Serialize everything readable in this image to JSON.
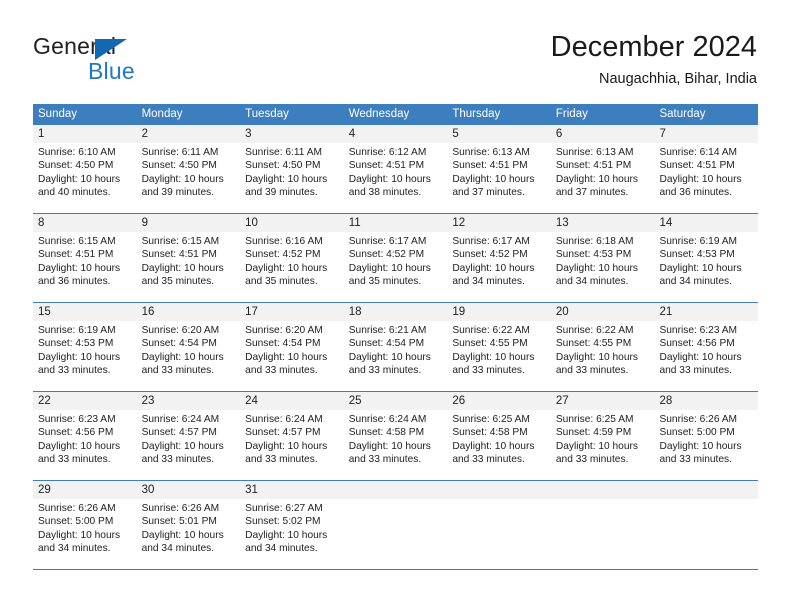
{
  "logo": {
    "primary_text": "General",
    "secondary_text": "Blue",
    "triangle_icon": "triangle-icon",
    "primary_color": "#231f20",
    "secondary_color": "#1f7ac4"
  },
  "header": {
    "title": "December 2024",
    "subtitle": "Naugachhia, Bihar, India"
  },
  "theme": {
    "header_blue": "#3d7ebe",
    "date_band_gray": "#f2f2f2",
    "text_color": "#222222"
  },
  "weekdays": [
    "Sunday",
    "Monday",
    "Tuesday",
    "Wednesday",
    "Thursday",
    "Friday",
    "Saturday"
  ],
  "weeks": [
    {
      "days": [
        {
          "date": "1",
          "sunrise": "Sunrise: 6:10 AM",
          "sunset": "Sunset: 4:50 PM",
          "daylight_1": "Daylight: 10 hours",
          "daylight_2": "and 40 minutes."
        },
        {
          "date": "2",
          "sunrise": "Sunrise: 6:11 AM",
          "sunset": "Sunset: 4:50 PM",
          "daylight_1": "Daylight: 10 hours",
          "daylight_2": "and 39 minutes."
        },
        {
          "date": "3",
          "sunrise": "Sunrise: 6:11 AM",
          "sunset": "Sunset: 4:50 PM",
          "daylight_1": "Daylight: 10 hours",
          "daylight_2": "and 39 minutes."
        },
        {
          "date": "4",
          "sunrise": "Sunrise: 6:12 AM",
          "sunset": "Sunset: 4:51 PM",
          "daylight_1": "Daylight: 10 hours",
          "daylight_2": "and 38 minutes."
        },
        {
          "date": "5",
          "sunrise": "Sunrise: 6:13 AM",
          "sunset": "Sunset: 4:51 PM",
          "daylight_1": "Daylight: 10 hours",
          "daylight_2": "and 37 minutes."
        },
        {
          "date": "6",
          "sunrise": "Sunrise: 6:13 AM",
          "sunset": "Sunset: 4:51 PM",
          "daylight_1": "Daylight: 10 hours",
          "daylight_2": "and 37 minutes."
        },
        {
          "date": "7",
          "sunrise": "Sunrise: 6:14 AM",
          "sunset": "Sunset: 4:51 PM",
          "daylight_1": "Daylight: 10 hours",
          "daylight_2": "and 36 minutes."
        }
      ]
    },
    {
      "days": [
        {
          "date": "8",
          "sunrise": "Sunrise: 6:15 AM",
          "sunset": "Sunset: 4:51 PM",
          "daylight_1": "Daylight: 10 hours",
          "daylight_2": "and 36 minutes."
        },
        {
          "date": "9",
          "sunrise": "Sunrise: 6:15 AM",
          "sunset": "Sunset: 4:51 PM",
          "daylight_1": "Daylight: 10 hours",
          "daylight_2": "and 35 minutes."
        },
        {
          "date": "10",
          "sunrise": "Sunrise: 6:16 AM",
          "sunset": "Sunset: 4:52 PM",
          "daylight_1": "Daylight: 10 hours",
          "daylight_2": "and 35 minutes."
        },
        {
          "date": "11",
          "sunrise": "Sunrise: 6:17 AM",
          "sunset": "Sunset: 4:52 PM",
          "daylight_1": "Daylight: 10 hours",
          "daylight_2": "and 35 minutes."
        },
        {
          "date": "12",
          "sunrise": "Sunrise: 6:17 AM",
          "sunset": "Sunset: 4:52 PM",
          "daylight_1": "Daylight: 10 hours",
          "daylight_2": "and 34 minutes."
        },
        {
          "date": "13",
          "sunrise": "Sunrise: 6:18 AM",
          "sunset": "Sunset: 4:53 PM",
          "daylight_1": "Daylight: 10 hours",
          "daylight_2": "and 34 minutes."
        },
        {
          "date": "14",
          "sunrise": "Sunrise: 6:19 AM",
          "sunset": "Sunset: 4:53 PM",
          "daylight_1": "Daylight: 10 hours",
          "daylight_2": "and 34 minutes."
        }
      ]
    },
    {
      "days": [
        {
          "date": "15",
          "sunrise": "Sunrise: 6:19 AM",
          "sunset": "Sunset: 4:53 PM",
          "daylight_1": "Daylight: 10 hours",
          "daylight_2": "and 33 minutes."
        },
        {
          "date": "16",
          "sunrise": "Sunrise: 6:20 AM",
          "sunset": "Sunset: 4:54 PM",
          "daylight_1": "Daylight: 10 hours",
          "daylight_2": "and 33 minutes."
        },
        {
          "date": "17",
          "sunrise": "Sunrise: 6:20 AM",
          "sunset": "Sunset: 4:54 PM",
          "daylight_1": "Daylight: 10 hours",
          "daylight_2": "and 33 minutes."
        },
        {
          "date": "18",
          "sunrise": "Sunrise: 6:21 AM",
          "sunset": "Sunset: 4:54 PM",
          "daylight_1": "Daylight: 10 hours",
          "daylight_2": "and 33 minutes."
        },
        {
          "date": "19",
          "sunrise": "Sunrise: 6:22 AM",
          "sunset": "Sunset: 4:55 PM",
          "daylight_1": "Daylight: 10 hours",
          "daylight_2": "and 33 minutes."
        },
        {
          "date": "20",
          "sunrise": "Sunrise: 6:22 AM",
          "sunset": "Sunset: 4:55 PM",
          "daylight_1": "Daylight: 10 hours",
          "daylight_2": "and 33 minutes."
        },
        {
          "date": "21",
          "sunrise": "Sunrise: 6:23 AM",
          "sunset": "Sunset: 4:56 PM",
          "daylight_1": "Daylight: 10 hours",
          "daylight_2": "and 33 minutes."
        }
      ]
    },
    {
      "days": [
        {
          "date": "22",
          "sunrise": "Sunrise: 6:23 AM",
          "sunset": "Sunset: 4:56 PM",
          "daylight_1": "Daylight: 10 hours",
          "daylight_2": "and 33 minutes."
        },
        {
          "date": "23",
          "sunrise": "Sunrise: 6:24 AM",
          "sunset": "Sunset: 4:57 PM",
          "daylight_1": "Daylight: 10 hours",
          "daylight_2": "and 33 minutes."
        },
        {
          "date": "24",
          "sunrise": "Sunrise: 6:24 AM",
          "sunset": "Sunset: 4:57 PM",
          "daylight_1": "Daylight: 10 hours",
          "daylight_2": "and 33 minutes."
        },
        {
          "date": "25",
          "sunrise": "Sunrise: 6:24 AM",
          "sunset": "Sunset: 4:58 PM",
          "daylight_1": "Daylight: 10 hours",
          "daylight_2": "and 33 minutes."
        },
        {
          "date": "26",
          "sunrise": "Sunrise: 6:25 AM",
          "sunset": "Sunset: 4:58 PM",
          "daylight_1": "Daylight: 10 hours",
          "daylight_2": "and 33 minutes."
        },
        {
          "date": "27",
          "sunrise": "Sunrise: 6:25 AM",
          "sunset": "Sunset: 4:59 PM",
          "daylight_1": "Daylight: 10 hours",
          "daylight_2": "and 33 minutes."
        },
        {
          "date": "28",
          "sunrise": "Sunrise: 6:26 AM",
          "sunset": "Sunset: 5:00 PM",
          "daylight_1": "Daylight: 10 hours",
          "daylight_2": "and 33 minutes."
        }
      ]
    },
    {
      "days": [
        {
          "date": "29",
          "sunrise": "Sunrise: 6:26 AM",
          "sunset": "Sunset: 5:00 PM",
          "daylight_1": "Daylight: 10 hours",
          "daylight_2": "and 34 minutes."
        },
        {
          "date": "30",
          "sunrise": "Sunrise: 6:26 AM",
          "sunset": "Sunset: 5:01 PM",
          "daylight_1": "Daylight: 10 hours",
          "daylight_2": "and 34 minutes."
        },
        {
          "date": "31",
          "sunrise": "Sunrise: 6:27 AM",
          "sunset": "Sunset: 5:02 PM",
          "daylight_1": "Daylight: 10 hours",
          "daylight_2": "and 34 minutes."
        },
        {
          "date": "",
          "sunrise": "",
          "sunset": "",
          "daylight_1": "",
          "daylight_2": ""
        },
        {
          "date": "",
          "sunrise": "",
          "sunset": "",
          "daylight_1": "",
          "daylight_2": ""
        },
        {
          "date": "",
          "sunrise": "",
          "sunset": "",
          "daylight_1": "",
          "daylight_2": ""
        },
        {
          "date": "",
          "sunrise": "",
          "sunset": "",
          "daylight_1": "",
          "daylight_2": ""
        }
      ]
    }
  ]
}
